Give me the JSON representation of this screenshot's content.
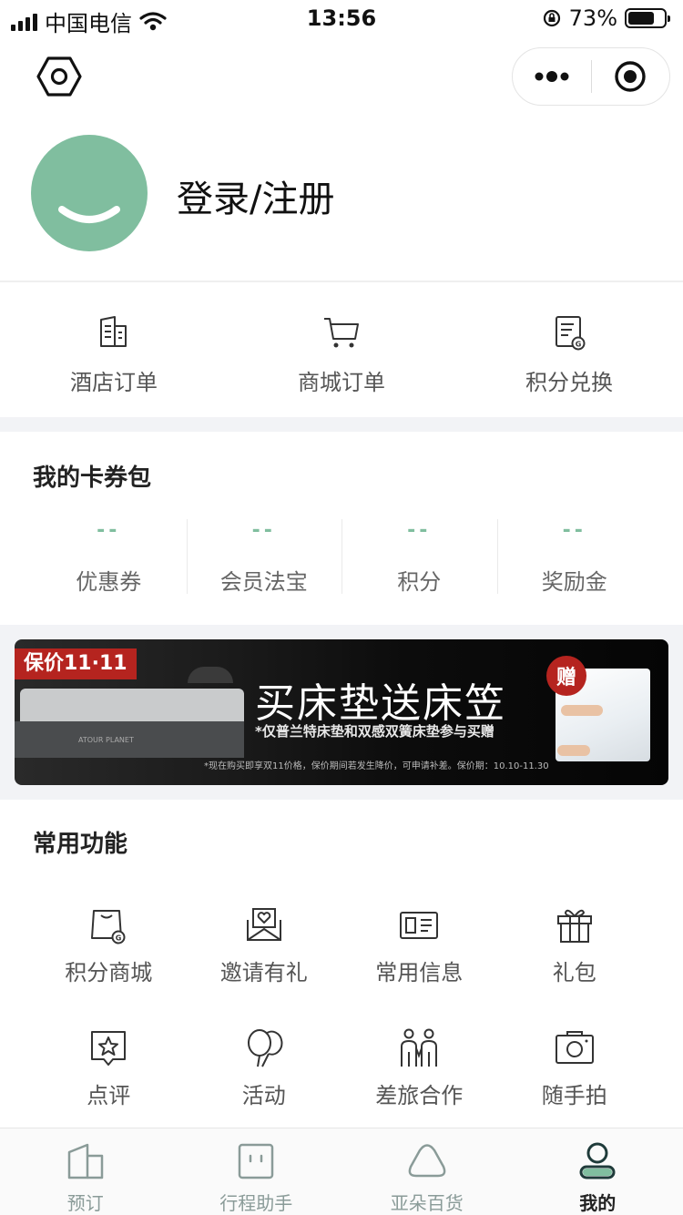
{
  "status_bar": {
    "carrier": "中国电信",
    "time": "13:56",
    "battery_text": "73%",
    "battery_level": 0.73
  },
  "nav": {
    "settings_icon": "hexagon-settings-icon",
    "more_icon": "more-dots-icon",
    "close_icon": "target-close-icon"
  },
  "profile": {
    "login_label": "登录/注册"
  },
  "orders": [
    {
      "label": "酒店订单",
      "icon": "hotel-order-icon"
    },
    {
      "label": "商城订单",
      "icon": "cart-icon"
    },
    {
      "label": "积分兑换",
      "icon": "points-exchange-icon"
    }
  ],
  "wallet": {
    "title": "我的卡券包",
    "items": [
      {
        "value": "--",
        "label": "优惠券"
      },
      {
        "value": "--",
        "label": "会员法宝"
      },
      {
        "value": "--",
        "label": "积分"
      },
      {
        "value": "--",
        "label": "奖励金"
      }
    ]
  },
  "banner": {
    "tag": "保价11·11",
    "title": "买床垫送床笠",
    "subtitle": "*仅普兰特床垫和双感双簧床垫参与买赠",
    "note": "*现在购买即享双11价格，保价期间若发生降价，可申请补差。保价期：10.10-11.30",
    "gift_badge": "赠",
    "bed_brand": "ATOUR PLANET"
  },
  "functions": {
    "title": "常用功能",
    "items": [
      {
        "label": "积分商城",
        "icon": "points-mall-icon"
      },
      {
        "label": "邀请有礼",
        "icon": "invite-envelope-icon"
      },
      {
        "label": "常用信息",
        "icon": "info-card-icon"
      },
      {
        "label": "礼包",
        "icon": "gift-box-icon"
      },
      {
        "label": "点评",
        "icon": "review-star-icon"
      },
      {
        "label": "活动",
        "icon": "balloon-icon"
      },
      {
        "label": "差旅合作",
        "icon": "people-icon"
      },
      {
        "label": "随手拍",
        "icon": "camera-icon"
      }
    ]
  },
  "tabbar": {
    "active": 3,
    "tabs": [
      {
        "label": "预订",
        "icon": "booking-icon"
      },
      {
        "label": "行程助手",
        "icon": "trip-assistant-icon"
      },
      {
        "label": "亚朵百货",
        "icon": "store-icon"
      },
      {
        "label": "我的",
        "icon": "profile-icon"
      }
    ]
  },
  "colors": {
    "accent_green": "#80be9f",
    "banner_red": "#b5241f",
    "section_gap": "#f2f3f6"
  }
}
